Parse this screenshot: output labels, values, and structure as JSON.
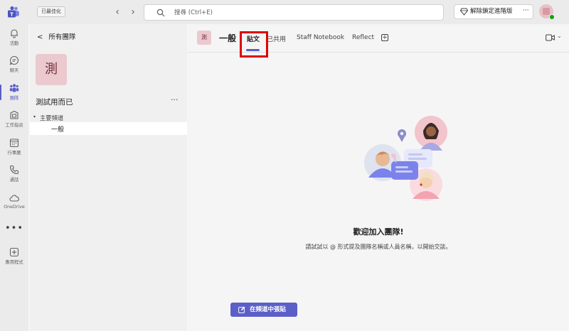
{
  "topbar": {
    "optimized_label": "已最佳化",
    "back_arrow": "‹",
    "forward_arrow": "›",
    "search_placeholder": "搜尋 (Ctrl+E)",
    "unlock_label": "解除鎖定進階版",
    "more_label": "···"
  },
  "rail": {
    "items": [
      {
        "label": "活動",
        "icon": "bell-icon"
      },
      {
        "label": "聊天",
        "icon": "chat-icon"
      },
      {
        "label": "團隊",
        "icon": "teams-icon"
      },
      {
        "label": "工作指派",
        "icon": "assignments-icon"
      },
      {
        "label": "行事曆",
        "icon": "calendar-icon"
      },
      {
        "label": "通話",
        "icon": "phone-icon"
      },
      {
        "label": "OneDrive",
        "icon": "cloud-icon"
      }
    ],
    "more": "•••",
    "apps_label": "應用程式",
    "active": "團隊",
    "accent_color": "#5b5fc7"
  },
  "teams_pane": {
    "back_label": "所有團隊",
    "team_initial": "測",
    "team_name": "測試用而已",
    "team_more": "···",
    "section_caret": "▾",
    "section_label": "主要頻道",
    "channel": "一般"
  },
  "channel_header": {
    "tile_initial": "測",
    "name": "一般",
    "tabs": [
      "貼文",
      "已共用",
      "Staff Notebook",
      "Reflect"
    ],
    "active_tab": "貼文",
    "add_tab": "+",
    "video_chevron": "⌄"
  },
  "welcome": {
    "title": "歡迎加入團隊!",
    "subtitle": "請試試以 @ 形式提及團隊名稱或人員名稱，以開始交談。"
  },
  "post_button": {
    "label": "在頻道中張貼"
  }
}
